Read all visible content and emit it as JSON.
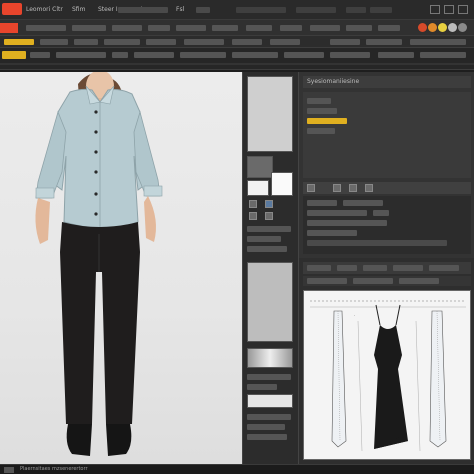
{
  "menu_bar": {
    "items": [
      "Leomori Cltr",
      "Sfim",
      "Steer Imesvesto",
      "Fsl"
    ]
  },
  "toolbar": {
    "accent_red": "#e8452c",
    "accent_yellow": "#e0b020",
    "palette_dots": [
      "#d64a2a",
      "#e08a2a",
      "#e8d040",
      "#bdbdbd",
      "#8a8a8a",
      "#555555"
    ]
  },
  "side_panel": {
    "title": "Syesiomaniiesine"
  },
  "status_bar": {
    "text": "Plaernsitaes mzsenerertorr"
  },
  "icons": {
    "model": "model-figure",
    "sketch": "dress-flat-sketch"
  }
}
